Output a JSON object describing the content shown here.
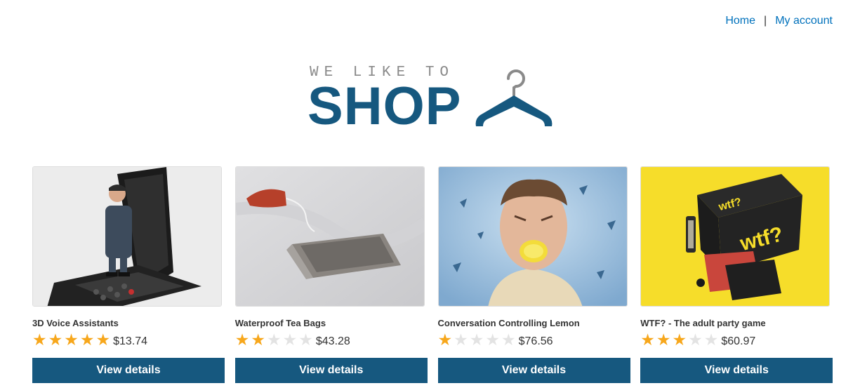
{
  "nav": {
    "home": "Home",
    "separator": "|",
    "account": "My account"
  },
  "logo": {
    "tagline": "WE LIKE TO",
    "wordmark": "SHOP",
    "color": "#16587f",
    "icon": "hanger-icon"
  },
  "products": [
    {
      "name": "3D Voice Assistants",
      "price": "$13.74",
      "rating": 5,
      "button": "View details",
      "image": "figure-on-phone"
    },
    {
      "name": "Waterproof Tea Bags",
      "price": "$43.28",
      "rating": 2,
      "button": "View details",
      "image": "tea-bag"
    },
    {
      "name": "Conversation Controlling Lemon",
      "price": "$76.56",
      "rating": 1,
      "button": "View details",
      "image": "man-with-lemon"
    },
    {
      "name": "WTF? - The adult party game",
      "price": "$60.97",
      "rating": 3,
      "button": "View details",
      "image": "party-game-box"
    }
  ],
  "colors": {
    "accent": "#16587f",
    "link": "#0071bc",
    "star_on": "#f7a71c",
    "star_off": "#e3e3e3"
  }
}
